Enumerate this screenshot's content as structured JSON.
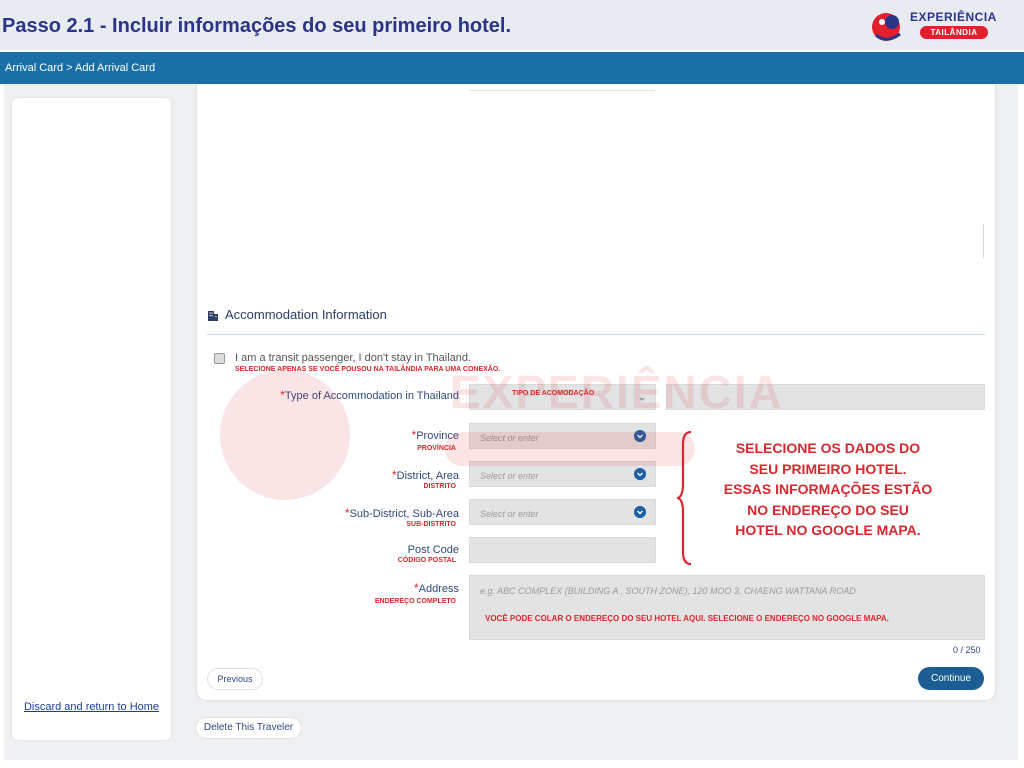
{
  "header": {
    "title": "Passo 2.1 - Incluir informações do seu primeiro hotel.",
    "brand_top": "EXPERIÊNCIA",
    "brand_bottom": "TAILÂNDIA"
  },
  "nav": {
    "breadcrumb": "Arrival Card > Add Arrival Card"
  },
  "sidebar": {
    "discard_link": "Discard and return to Home"
  },
  "section": {
    "title": "Accommodation Information"
  },
  "transit": {
    "label": "I am a transit passenger, I don't stay in Thailand.",
    "note": "SELECIONE APENAS SE VOCÊ POUSOU NA TAILÂNDIA PARA UMA CONEXÃO.",
    "checked": false
  },
  "fields": {
    "type": {
      "label": "Type of Accommodation in Thailand",
      "overlay": "TIPO DE ACOMODAÇÃO"
    },
    "province": {
      "label": "Province",
      "sub": "PROVÍNCIA",
      "placeholder": "Select or enter"
    },
    "district": {
      "label": "District, Area",
      "sub": "DISTRITO",
      "placeholder": "Select or enter"
    },
    "subdistrict": {
      "label": "Sub-District, Sub-Area",
      "sub": "SUB-DISTRITO",
      "placeholder": "Select or enter"
    },
    "postcode": {
      "label": "Post Code",
      "sub": "CÓDIGO POSTAL"
    },
    "address": {
      "label": "Address",
      "sub": "ENDEREÇO COMPLETO",
      "placeholder": "e.g. ABC COMPLEX (BUILDING A , SOUTH ZONE), 120 MOO 3, CHAENG WATTANA ROAD",
      "overlay": "VOCÊ PODE COLAR O ENDEREÇO DO SEU HOTEL AQUI. SELECIONE O ENDEREÇO NO GOOGLE MAPA.",
      "counter": "0 / 250"
    }
  },
  "required_mark": "*",
  "buttons": {
    "previous": "Previous",
    "continue": "Continue",
    "delete": "Delete This Traveler"
  },
  "annotation": [
    "SELECIONE  OS DADOS DO",
    "SEU PRIMEIRO HOTEL.",
    "ESSAS INFORMAÇÕES ESTÃO",
    "NO ENDEREÇO DO SEU",
    "HOTEL NO GOOGLE MAPA."
  ],
  "watermark": {
    "text": "EXPERIÊNCIA"
  },
  "colors": {
    "title_blue": "#2b3487",
    "nav_blue": "#1a6fa6",
    "annotation_red": "#d8272e",
    "continue_button": "#1c5d93",
    "field_grey": "#e3e3e3"
  }
}
